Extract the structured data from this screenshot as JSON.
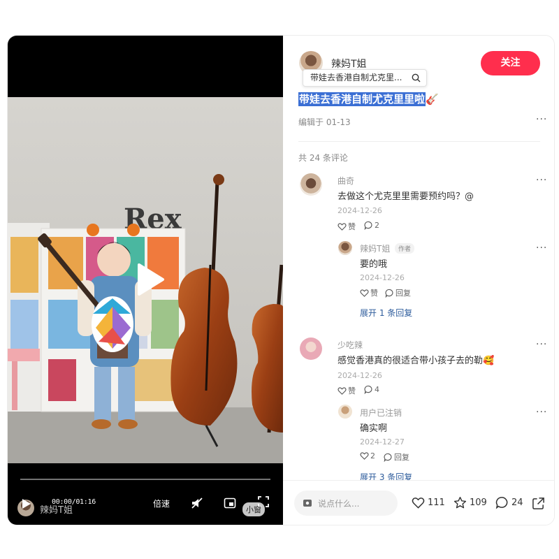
{
  "video": {
    "progress": 0.0,
    "time": "00:00/01:16",
    "speed_label": "倍速",
    "size_label": "小窗",
    "watermark_name": "辣妈T姐",
    "scene_sign": "Rex"
  },
  "author": {
    "name": "辣妈T姐",
    "follow_label": "关注"
  },
  "search_suggestion": "带娃去香港自制尤克里...",
  "note": {
    "title": "带娃去香港自制尤克里里啦",
    "title_emoji": "🎸",
    "edit_date": "编辑于 01-13"
  },
  "comments_header": "共 24 条评论",
  "comments": [
    {
      "name": "曲奇",
      "text": "去做这个尤克里里需要预约吗？@",
      "date": "2024-12-26",
      "like_label": "赞",
      "reply_count": "2",
      "reply": {
        "name": "辣妈T姐",
        "tag": "作者",
        "text": "要的哦",
        "date": "2024-12-26",
        "like_label": "赞",
        "reply_label_like": "赞",
        "reply_label": "回复"
      },
      "expand": "展开 1 条回复"
    },
    {
      "name": "少吃辣",
      "text": "感觉香港真的很适合带小孩子去的勒",
      "emoji": "🥰",
      "date": "2024-12-26",
      "like_label": "赞",
      "reply_count": "4",
      "reply": {
        "name": "用户已注销",
        "text": "确实啊",
        "date": "2024-12-27",
        "like_count": "2",
        "reply_label": "回复"
      },
      "expand": "展开 3 条回复"
    }
  ],
  "bottom": {
    "input_placeholder": "说点什么...",
    "likes": "111",
    "collects": "109",
    "comments": "24"
  },
  "colors": {
    "accent": "#ff2e4d",
    "link": "#2e5c9c",
    "highlight": "#3b6fd4"
  }
}
